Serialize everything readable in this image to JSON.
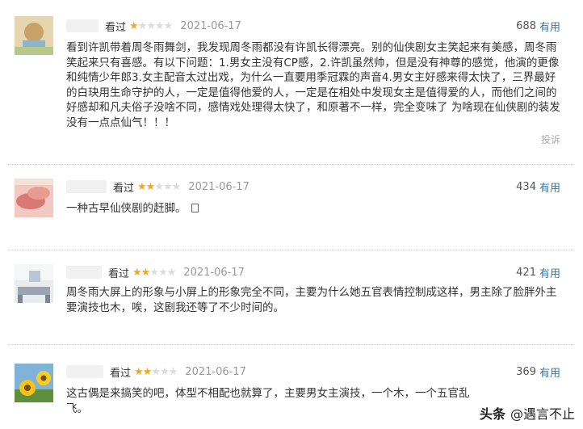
{
  "reviews": [
    {
      "watched_label": "看过",
      "rating": 1,
      "max_rating": 5,
      "date": "2021-06-17",
      "vote_count": "688",
      "useful_label": "有用",
      "text": "看到许凯带着周冬雨舞剑，我发现周冬雨都没有许凯长得漂亮。别的仙侠剧女主笑起来有美感，周冬雨笑起来只有喜感。有以下问题：1.男女主没有CP感，2.许凯虽然帅，但是没有神尊的感觉，他演的更像和纯情少年郎3.女主配音太过出戏，为什么一直要用季冠霖的声音4.男女主好感来得太快了，三界最好的白玦用生命守护的人，一定是值得他爱的人，一定是在相处中发现女主是值得爱的人，而他们之间的好感却和凡夫俗子没啥不同，感情戏处理得太快了，和原著不一样，完全变味了 为啥现在仙侠剧的装发没有一点点仙气！！！",
      "report_label": "投诉"
    },
    {
      "watched_label": "看过",
      "rating": 2,
      "max_rating": 5,
      "date": "2021-06-17",
      "vote_count": "434",
      "useful_label": "有用",
      "text": "一种古早仙侠剧的赶脚。"
    },
    {
      "watched_label": "看过",
      "rating": 2,
      "max_rating": 5,
      "date": "2021-06-17",
      "vote_count": "421",
      "useful_label": "有用",
      "text": "周冬雨大屏上的形象与小屏上的形象完全不同，主要为什么她五官表情控制成这样，男主除了脸胖外主要演技也木，唉，这剧我还等了不少时间的。"
    },
    {
      "watched_label": "看过",
      "rating": 2,
      "max_rating": 5,
      "date": "2021-06-17",
      "vote_count": "369",
      "useful_label": "有用",
      "text": "这古偶是来搞笑的吧，体型不相配也就算了，主要男女主演技，一个木，一个五官乱飞。"
    }
  ],
  "watermark": {
    "logo_text": "头条",
    "account": "@遇言不止"
  },
  "colors": {
    "star_on": "#f5a623",
    "star_off": "#dcdcdc",
    "useful_link": "#3377aa",
    "date": "#999999"
  }
}
